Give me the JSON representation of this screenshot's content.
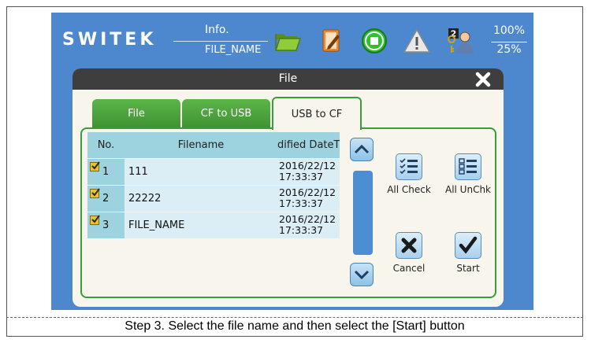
{
  "header": {
    "logo": "SWITEK",
    "info_label": "Info.",
    "info_value": "FILE_NAME",
    "percent_top": "100%",
    "percent_bottom": "25%",
    "user_level": "2"
  },
  "dialog": {
    "title": "File",
    "tabs": [
      {
        "label": "File",
        "active": false
      },
      {
        "label": "CF to USB",
        "active": false
      },
      {
        "label": "USB to CF",
        "active": true
      }
    ],
    "table": {
      "columns": [
        "No.",
        "Filename",
        "dified DateTi"
      ],
      "rows": [
        {
          "no": "1",
          "filename": "111",
          "date": "2016/22/12",
          "time": "17:33:37",
          "checked": true
        },
        {
          "no": "2",
          "filename": "22222",
          "date": "2016/22/12",
          "time": "17:33:37",
          "checked": true
        },
        {
          "no": "3",
          "filename": "FILE_NAME",
          "date": "2016/22/12",
          "time": "17:33:37",
          "checked": true
        }
      ]
    },
    "buttons": {
      "all_check": "All Check",
      "all_uncheck": "All UnChk",
      "cancel": "Cancel",
      "start": "Start"
    }
  },
  "caption": "Step 3. Select the file name and then select the [Start] button",
  "colors": {
    "screen_bg": "#4d88cf",
    "tab_green": "#4aa63c",
    "header_cell": "#9dd3df",
    "row_cell": "#dbeef5",
    "checkbox": "#e9c22e"
  }
}
